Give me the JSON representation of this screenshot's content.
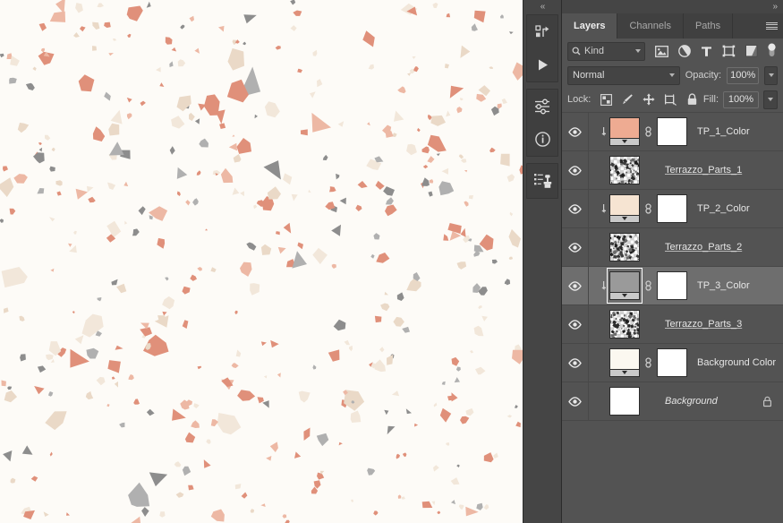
{
  "app": {
    "name": "Adobe Photoshop",
    "panel_bg": "#535353",
    "panel_dark": "#454545",
    "selected_row_bg": "#6e6e6e"
  },
  "canvas": {
    "name": "terrazzo-pattern-canvas",
    "background_color": "#fdfbf7",
    "chip_colors": {
      "coral": "#e0907a",
      "coral_light": "#edb8a4",
      "gray": "#8d8d8d",
      "gray_light": "#b0b0b0",
      "cream": "#f2e7da",
      "cream_deep": "#ead9c7"
    }
  },
  "icon_rail": {
    "collapse_label": "«",
    "groups": [
      {
        "name": "history-actions-group",
        "buttons": [
          {
            "icon": "history-icon",
            "title": "History"
          },
          {
            "icon": "play-icon",
            "title": "Actions"
          }
        ]
      },
      {
        "name": "adjustments-info-group",
        "buttons": [
          {
            "icon": "adjustments-sliders-icon",
            "title": "Adjustments"
          },
          {
            "icon": "info-icon",
            "title": "Info"
          }
        ]
      },
      {
        "name": "clone-source-group",
        "buttons": [
          {
            "icon": "clone-source-stamp-icon",
            "title": "Clone Source"
          }
        ]
      }
    ]
  },
  "panel": {
    "expand_label": "»",
    "menu_icon": "panel-menu-icon",
    "tabs": [
      {
        "label": "Layers",
        "active": true
      },
      {
        "label": "Channels",
        "active": false
      },
      {
        "label": "Paths",
        "active": false
      }
    ]
  },
  "filter_bar": {
    "search_icon": "search-icon",
    "kind_value": "Kind",
    "kind_caret": "chevron-down-icon",
    "icons": [
      {
        "name": "filter-pixel-icon",
        "title": "Filter for pixel layers"
      },
      {
        "name": "filter-adjustment-icon",
        "title": "Filter for adjustment layers"
      },
      {
        "name": "filter-type-icon",
        "title": "Filter for type layers",
        "glyph": "T"
      },
      {
        "name": "filter-shape-icon",
        "title": "Filter for shape layers"
      },
      {
        "name": "filter-smart-object-icon",
        "title": "Filter for smart objects"
      }
    ],
    "toggle": {
      "name": "filter-enable-toggle",
      "state": "on"
    }
  },
  "blend_bar": {
    "blend_mode": "Normal",
    "blend_caret": "chevron-down-icon",
    "opacity_label": "Opacity:",
    "opacity_value": "100%",
    "opacity_caret": "chevron-down-icon"
  },
  "lock_bar": {
    "lock_label": "Lock:",
    "buttons": [
      {
        "name": "lock-transparent-pixels-icon",
        "title": "Lock transparent pixels"
      },
      {
        "name": "lock-image-pixels-brush-icon",
        "title": "Lock image pixels"
      },
      {
        "name": "lock-position-move-icon",
        "title": "Lock position"
      },
      {
        "name": "lock-artboard-nesting-icon",
        "title": "Prevent auto-nesting"
      },
      {
        "name": "lock-all-padlock-icon",
        "title": "Lock all"
      }
    ],
    "fill_label": "Fill:",
    "fill_value": "100%",
    "fill_caret": "chevron-down-icon"
  },
  "layers": [
    {
      "name": "TP_1_Color",
      "visible": true,
      "selected": false,
      "type": "solid-fill",
      "clipped": true,
      "linked": true,
      "fill_color": "#eeab92",
      "has_mask": true,
      "mask_color": "#ffffff",
      "locked": false,
      "name_style": "normal"
    },
    {
      "name": "Terrazzo_Parts_1",
      "visible": true,
      "selected": false,
      "type": "pixel",
      "clipped": false,
      "linked": false,
      "has_mask": false,
      "locked": false,
      "name_style": "underlined"
    },
    {
      "name": "TP_2_Color",
      "visible": true,
      "selected": false,
      "type": "solid-fill",
      "clipped": true,
      "linked": true,
      "fill_color": "#f6e4d2",
      "has_mask": true,
      "mask_color": "#ffffff",
      "locked": false,
      "name_style": "normal"
    },
    {
      "name": "Terrazzo_Parts_2",
      "visible": true,
      "selected": false,
      "type": "pixel",
      "clipped": false,
      "linked": false,
      "has_mask": false,
      "locked": false,
      "name_style": "underlined"
    },
    {
      "name": "TP_3_Color",
      "visible": true,
      "selected": true,
      "type": "solid-fill",
      "clipped": true,
      "linked": true,
      "fill_color": "#9a9a9a",
      "has_mask": true,
      "mask_color": "#ffffff",
      "locked": false,
      "name_style": "normal"
    },
    {
      "name": "Terrazzo_Parts_3",
      "visible": true,
      "selected": false,
      "type": "pixel",
      "clipped": false,
      "linked": false,
      "has_mask": false,
      "locked": false,
      "name_style": "underlined"
    },
    {
      "name": "Background Color",
      "visible": true,
      "selected": false,
      "type": "solid-fill",
      "clipped": false,
      "linked": true,
      "fill_color": "#fbf8f0",
      "has_mask": true,
      "mask_color": "#ffffff",
      "locked": false,
      "name_style": "normal"
    },
    {
      "name": "Background",
      "visible": true,
      "selected": false,
      "type": "background",
      "clipped": false,
      "linked": false,
      "fill_color": "#ffffff",
      "has_mask": false,
      "locked": true,
      "name_style": "italic"
    }
  ]
}
